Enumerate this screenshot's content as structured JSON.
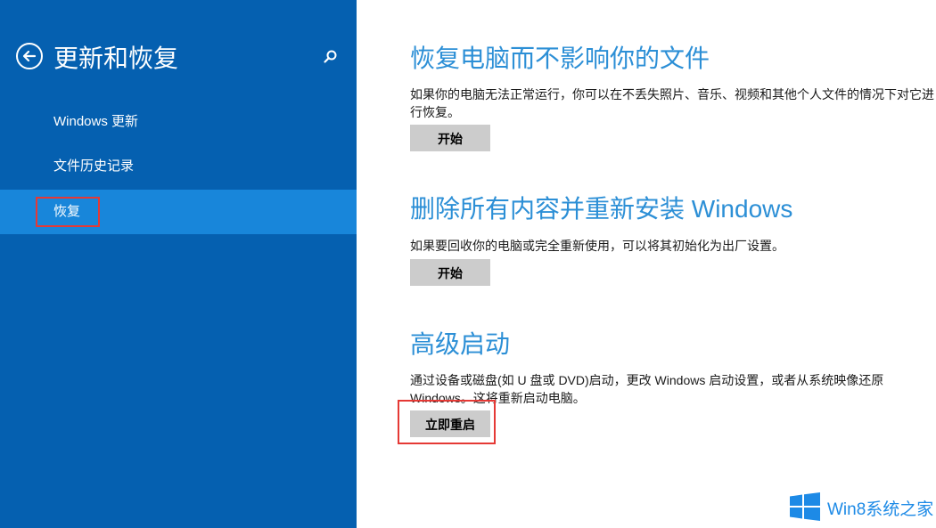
{
  "sidebar": {
    "title": "更新和恢复",
    "items": [
      {
        "label": "Windows 更新"
      },
      {
        "label": "文件历史记录"
      },
      {
        "label": "恢复"
      }
    ]
  },
  "sections": [
    {
      "title": "恢复电脑而不影响你的文件",
      "description": "如果你的电脑无法正常运行，你可以在不丢失照片、音乐、视频和其他个人文件的情况下对它进行恢复。",
      "button_label": "开始"
    },
    {
      "title": "删除所有内容并重新安装 Windows",
      "description": "如果要回收你的电脑或完全重新使用，可以将其初始化为出厂设置。",
      "button_label": "开始"
    },
    {
      "title": "高级启动",
      "description": "通过设备或磁盘(如 U 盘或 DVD)启动，更改 Windows 启动设置，或者从系统映像还原 Windows。这将重新启动电脑。",
      "button_label": "立即重启"
    }
  ],
  "watermark": {
    "text": "Win8系统之家"
  },
  "colors": {
    "sidebar_bg": "#0560b0",
    "active_item_bg": "#1886da",
    "heading": "#2c8fd6",
    "highlight_border": "#e53935"
  },
  "icons": {
    "back": "back-arrow-icon",
    "search": "search-icon",
    "logo": "windows-logo-icon"
  }
}
